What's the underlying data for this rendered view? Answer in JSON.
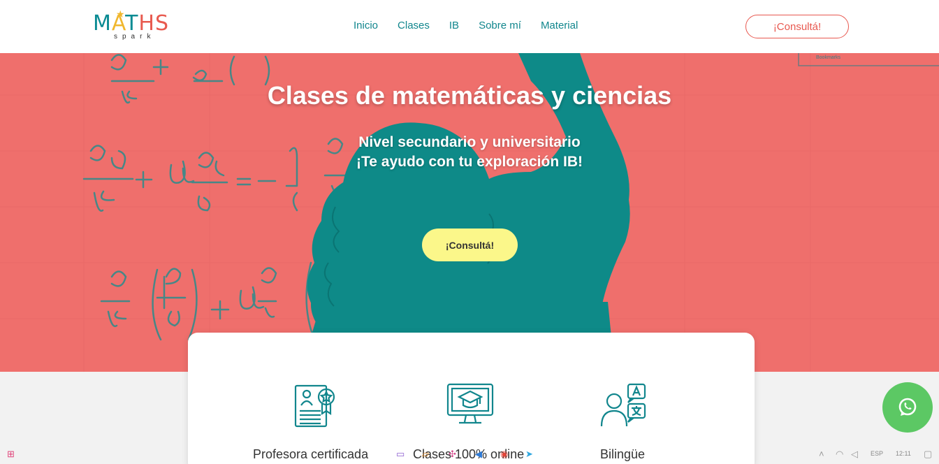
{
  "header": {
    "logo_text": "MATHS",
    "logo_sub": "spark",
    "nav": [
      "Inicio",
      "Clases",
      "IB",
      "Sobre mí",
      "Material"
    ],
    "cta_label": "¡Consultá!"
  },
  "hero": {
    "title": "Clases de matemáticas y ciencias",
    "subtitle_line1": "Nivel secundario y universitario",
    "subtitle_line2": "¡Te ayudo con tu exploración IB!",
    "cta_label": "¡Consultá!",
    "bookmark_text": "Bookmarks"
  },
  "features": [
    {
      "label": "Profesora certificada",
      "icon": "certificate-icon"
    },
    {
      "label": "Clases 100% online",
      "icon": "online-class-icon"
    },
    {
      "label": "Bilingüe",
      "icon": "bilingual-icon"
    }
  ],
  "whatsapp": {
    "icon": "whatsapp-icon"
  },
  "taskbar": {
    "lang": "ESP",
    "time": "12:11"
  },
  "colors": {
    "teal": "#0a8b93",
    "coral": "#ef6f6c",
    "yellow": "#fbf78a",
    "green": "#5cc864"
  }
}
